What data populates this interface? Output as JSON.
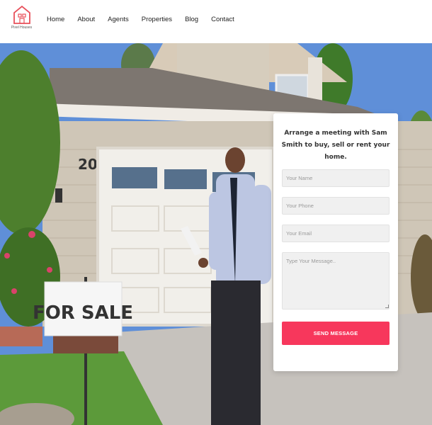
{
  "logo": {
    "text": "Pixel Houses",
    "icon": "house-icon",
    "color": "#e8505b"
  },
  "nav": {
    "items": [
      {
        "label": "Home"
      },
      {
        "label": "About"
      },
      {
        "label": "Agents"
      },
      {
        "label": "Properties"
      },
      {
        "label": "Blog"
      },
      {
        "label": "Contact"
      }
    ]
  },
  "hero": {
    "house_number": "20",
    "sign_text": "FOR SALE"
  },
  "form": {
    "title": "Arrange a meeting with Sam Smith to buy, sell or rent your home.",
    "name_placeholder": "Your Name",
    "phone_placeholder": "Your Phone",
    "email_placeholder": "Your Email",
    "message_placeholder": "Type Your Message..",
    "submit_label": "SEND MESSAGE",
    "accent_color": "#f7375c"
  }
}
